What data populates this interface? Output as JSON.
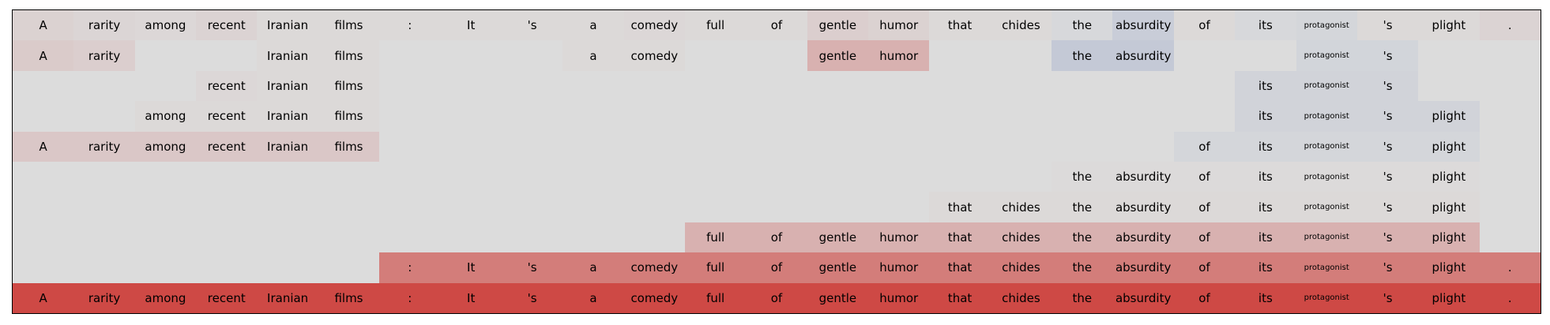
{
  "tokens": [
    "A",
    "rarity",
    "among",
    "recent",
    "Iranian",
    "films",
    ":",
    "It",
    "'s",
    "a",
    "comedy",
    "full",
    "of",
    "gentle",
    "humor",
    "that",
    "chides",
    "the",
    "absurdity",
    "of",
    "its",
    "protagonist",
    "'s",
    "plight",
    "."
  ],
  "rows": [
    [
      0.06,
      0.04,
      0.03,
      0.05,
      0.02,
      0.02,
      0.02,
      0.02,
      0.02,
      0.02,
      0.03,
      0.02,
      0.02,
      0.08,
      0.06,
      0.02,
      0.02,
      -0.03,
      -0.12,
      0.02,
      -0.03,
      -0.05,
      0.02,
      0.02,
      0.05
    ],
    [
      0.1,
      0.08,
      null,
      null,
      0.02,
      0.02,
      null,
      null,
      null,
      0.02,
      0.02,
      null,
      null,
      0.25,
      0.25,
      null,
      null,
      -0.15,
      -0.15,
      null,
      null,
      -0.06,
      -0.06,
      null,
      null
    ],
    [
      null,
      null,
      null,
      0.03,
      0.02,
      0.02,
      null,
      null,
      null,
      null,
      null,
      null,
      null,
      null,
      null,
      null,
      null,
      null,
      null,
      null,
      -0.07,
      -0.07,
      -0.07,
      null,
      null
    ],
    [
      null,
      null,
      0.02,
      0.02,
      0.02,
      0.02,
      null,
      null,
      null,
      null,
      null,
      null,
      null,
      null,
      null,
      null,
      null,
      null,
      null,
      null,
      -0.07,
      -0.07,
      -0.07,
      -0.07,
      null
    ],
    [
      0.12,
      0.12,
      0.12,
      0.12,
      0.12,
      0.12,
      null,
      null,
      null,
      null,
      null,
      null,
      null,
      null,
      null,
      null,
      null,
      null,
      null,
      -0.05,
      -0.05,
      -0.05,
      -0.05,
      -0.05,
      null
    ],
    [
      null,
      null,
      null,
      null,
      null,
      null,
      null,
      null,
      null,
      null,
      null,
      null,
      null,
      null,
      null,
      null,
      null,
      0.01,
      0.01,
      0.01,
      0.01,
      0.01,
      0.01,
      0.01,
      null
    ],
    [
      null,
      null,
      null,
      null,
      null,
      null,
      null,
      null,
      null,
      null,
      null,
      null,
      null,
      null,
      null,
      0.02,
      0.02,
      0.02,
      0.02,
      0.02,
      0.02,
      0.02,
      0.02,
      0.02,
      null
    ],
    [
      null,
      null,
      null,
      null,
      null,
      null,
      null,
      null,
      null,
      null,
      null,
      0.25,
      0.25,
      0.25,
      0.25,
      0.25,
      0.25,
      0.25,
      0.25,
      0.25,
      0.25,
      0.25,
      0.25,
      0.25,
      null
    ],
    [
      null,
      null,
      null,
      null,
      null,
      null,
      0.55,
      0.55,
      0.55,
      0.55,
      0.55,
      0.55,
      0.55,
      0.55,
      0.55,
      0.55,
      0.55,
      0.55,
      0.55,
      0.55,
      0.55,
      0.55,
      0.55,
      0.55,
      0.55
    ],
    [
      0.85,
      0.85,
      0.85,
      0.85,
      0.85,
      0.85,
      0.85,
      0.85,
      0.85,
      0.85,
      0.85,
      0.85,
      0.85,
      0.85,
      0.85,
      0.85,
      0.85,
      0.85,
      0.85,
      0.85,
      0.85,
      0.85,
      0.85,
      0.85,
      0.85
    ]
  ],
  "small_tokens": [
    21
  ],
  "colors": {
    "background": "#dcdcdc",
    "positive": "#cc2f2a",
    "negative": "#3b5fb7",
    "text": "#000000"
  }
}
